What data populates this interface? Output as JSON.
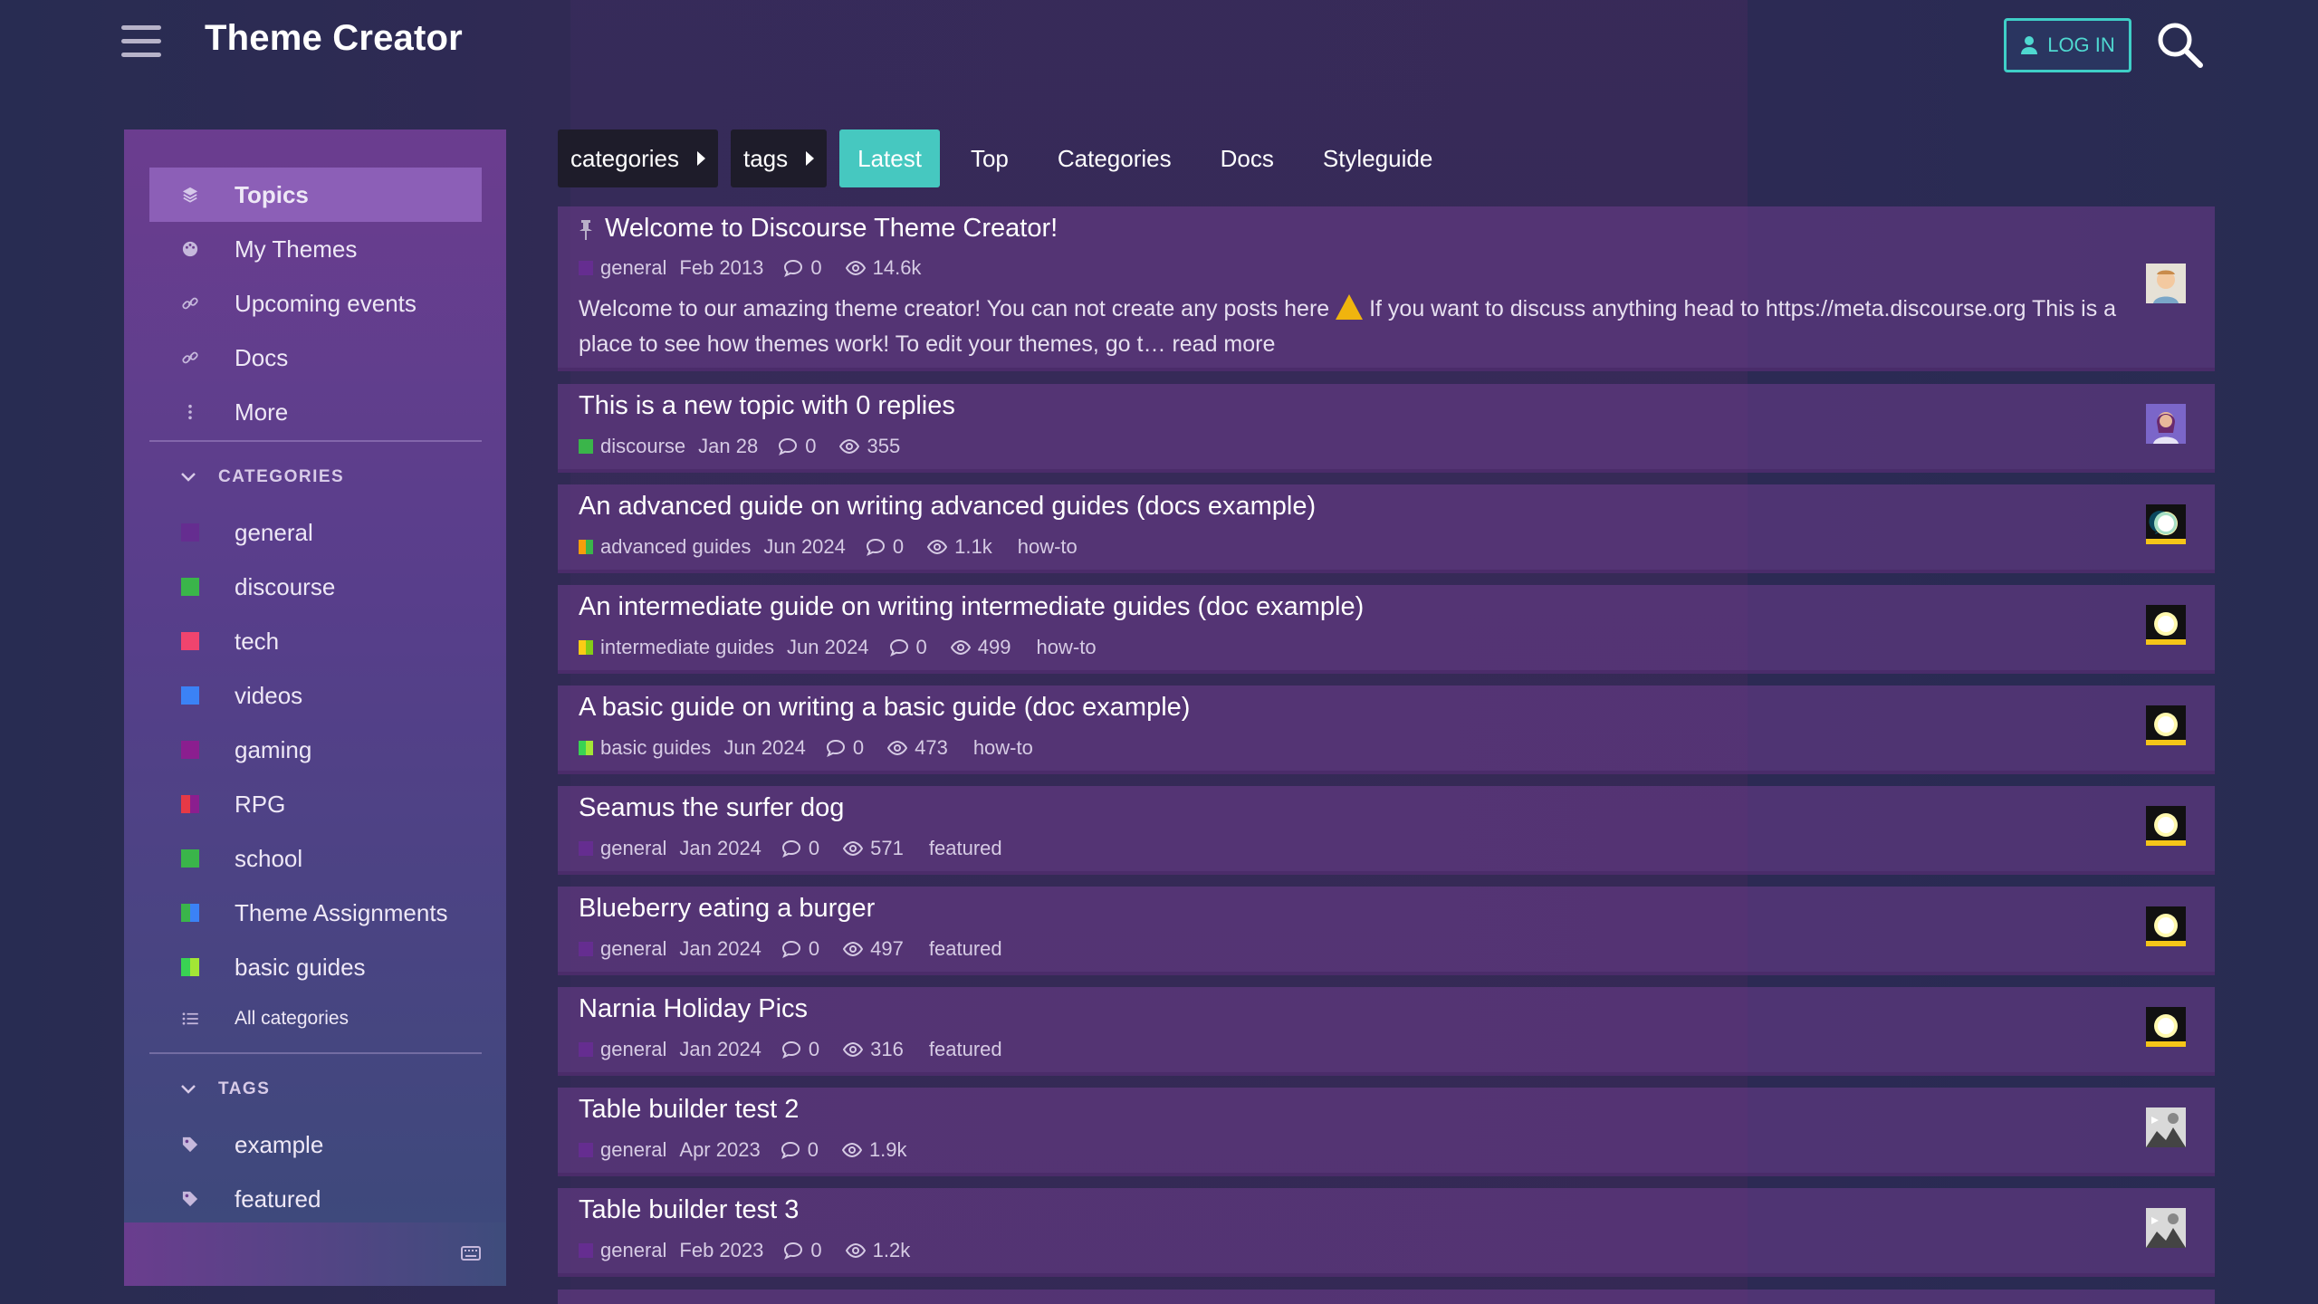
{
  "header": {
    "title": "Theme Creator",
    "login_label": "LOG IN"
  },
  "sidebar": {
    "main_items": [
      {
        "label": "Topics",
        "icon": "layers-icon"
      },
      {
        "label": "My Themes",
        "icon": "palette-icon"
      },
      {
        "label": "Upcoming events",
        "icon": "link-icon"
      },
      {
        "label": "Docs",
        "icon": "link-icon"
      },
      {
        "label": "More",
        "icon": "more-vertical-icon"
      }
    ],
    "categories_heading": "CATEGORIES",
    "categories": [
      {
        "label": "general",
        "color": "#652d90"
      },
      {
        "label": "discourse",
        "color": "#3ab54a"
      },
      {
        "label": "tech",
        "color": "#f0446e"
      },
      {
        "label": "videos",
        "color": "#3b82f6"
      },
      {
        "label": "gaming",
        "color": "#8b1e8f"
      },
      {
        "label": "RPG",
        "colors": [
          "#e63946",
          "#8b1e8f"
        ]
      },
      {
        "label": "school",
        "color": "#3ab54a"
      },
      {
        "label": "Theme Assignments",
        "colors": [
          "#3ab54a",
          "#3b82f6"
        ]
      },
      {
        "label": "basic guides",
        "colors": [
          "#39d353",
          "#a3e635"
        ]
      }
    ],
    "all_categories_label": "All categories",
    "tags_heading": "TAGS",
    "tags": [
      {
        "label": "example"
      },
      {
        "label": "featured"
      }
    ]
  },
  "nav": {
    "categories_dropdown": "categories",
    "tags_dropdown": "tags",
    "links": [
      "Latest",
      "Top",
      "Categories",
      "Docs",
      "Styleguide"
    ],
    "active": "Latest"
  },
  "topics": [
    {
      "title": "Welcome to Discourse Theme Creator!",
      "pinned": true,
      "category": "general",
      "category_color": "#652d90",
      "date": "Feb 2013",
      "replies": "0",
      "views": "14.6k",
      "tag": "",
      "excerpt_before": "Welcome to our amazing theme creator! You can not create any posts here",
      "excerpt_after": "If you want to discuss anything head to https://meta.discourse.org This is a place to see how themes work! To edit your themes, go t…",
      "read_more": "read more",
      "avatar": "person-avatar"
    },
    {
      "title": "This is a new topic with 0 replies",
      "category": "discourse",
      "category_color": "#3ab54a",
      "date": "Jan 28",
      "replies": "0",
      "views": "355",
      "tag": "",
      "avatar": "woman-avatar"
    },
    {
      "title": "An advanced guide on writing advanced guides (docs example)",
      "category": "advanced guides",
      "category_colors": [
        "#f59e0b",
        "#3ab54a"
      ],
      "date": "Jun 2024",
      "replies": "0",
      "views": "1.1k",
      "tag": "how-to",
      "avatar": "discourse-avatar"
    },
    {
      "title": "An intermediate guide on writing intermediate guides (doc example)",
      "category": "intermediate guides",
      "category_colors": [
        "#facc15",
        "#84cc16"
      ],
      "date": "Jun 2024",
      "replies": "0",
      "views": "499",
      "tag": "how-to",
      "avatar": "discourse-avatar"
    },
    {
      "title": "A basic guide on writing a basic guide (doc example)",
      "category": "basic guides",
      "category_colors": [
        "#39d353",
        "#a3e635"
      ],
      "date": "Jun 2024",
      "replies": "0",
      "views": "473",
      "tag": "how-to",
      "avatar": "discourse-avatar"
    },
    {
      "title": "Seamus the surfer dog",
      "category": "general",
      "category_color": "#652d90",
      "date": "Jan 2024",
      "replies": "0",
      "views": "571",
      "tag": "featured",
      "avatar": "discourse-avatar"
    },
    {
      "title": "Blueberry eating a burger",
      "category": "general",
      "category_color": "#652d90",
      "date": "Jan 2024",
      "replies": "0",
      "views": "497",
      "tag": "featured",
      "avatar": "discourse-avatar"
    },
    {
      "title": "Narnia Holiday Pics",
      "category": "general",
      "category_color": "#652d90",
      "date": "Jan 2024",
      "replies": "0",
      "views": "316",
      "tag": "featured",
      "avatar": "discourse-avatar"
    },
    {
      "title": "Table builder test 2",
      "category": "general",
      "category_color": "#652d90",
      "date": "Apr 2023",
      "replies": "0",
      "views": "1.9k",
      "tag": "",
      "avatar": "photo-avatar"
    },
    {
      "title": "Table builder test 3",
      "category": "general",
      "category_color": "#652d90",
      "date": "Feb 2023",
      "replies": "0",
      "views": "1.2k",
      "tag": "",
      "avatar": "photo-avatar"
    }
  ]
}
